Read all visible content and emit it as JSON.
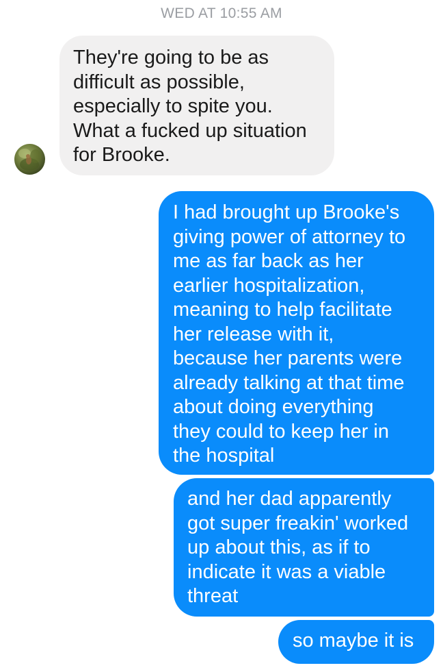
{
  "conversation": {
    "timestamp": "WED AT 10:55 AM",
    "messages": [
      {
        "direction": "incoming",
        "text": "They're going to be as\ndifficult as possible,\nespecially to spite you.\nWhat a fucked up situation\nfor Brooke."
      },
      {
        "direction": "outgoing",
        "text": "I had brought up Brooke's\ngiving power of attorney to\nme as far back as her\nearlier hospitalization,\nmeaning to help facilitate\nher release with it,\nbecause her parents were\nalready talking at that time\nabout doing everything\nthey could to keep her in\nthe hospital"
      },
      {
        "direction": "outgoing",
        "text": "and her dad apparently\ngot super freakin' worked\nup about this, as if to\nindicate it was a viable\nthreat"
      },
      {
        "direction": "outgoing",
        "text": "so maybe it is"
      }
    ]
  },
  "contact": {
    "avatar_icon": "contact-avatar-photo"
  },
  "colors": {
    "outgoing_bubble": "#0a8cfb",
    "incoming_bubble": "#f1f0f0",
    "timestamp_text": "#9a9da2"
  }
}
